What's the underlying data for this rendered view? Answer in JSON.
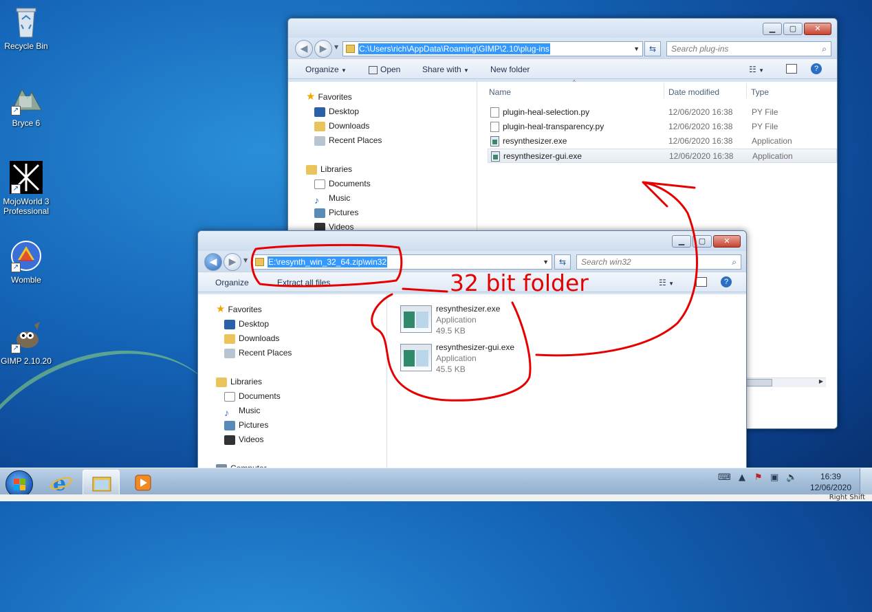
{
  "desktop": {
    "icons": [
      {
        "label": "Recycle Bin",
        "icon": "recycle-bin-icon"
      },
      {
        "label": "Bryce 6",
        "icon": "bryce-icon"
      },
      {
        "label": "MojoWorld 3 Professional",
        "icon": "mojoworld-icon"
      },
      {
        "label": "Womble",
        "icon": "womble-icon"
      },
      {
        "label": "GIMP 2.10.20",
        "icon": "gimp-icon"
      }
    ]
  },
  "window_back": {
    "address": "C:\\Users\\rich\\AppData\\Roaming\\GIMP\\2.10\\plug-ins",
    "search_placeholder": "Search plug-ins",
    "toolbar": {
      "organize": "Organize",
      "open": "Open",
      "share_with": "Share with",
      "new_folder": "New folder"
    },
    "nav": {
      "favorites": "Favorites",
      "favorites_items": [
        "Desktop",
        "Downloads",
        "Recent Places"
      ],
      "libraries": "Libraries",
      "libraries_items": [
        "Documents",
        "Music",
        "Pictures",
        "Videos"
      ]
    },
    "columns": {
      "name": "Name",
      "date": "Date modified",
      "type": "Type"
    },
    "files": [
      {
        "name": "plugin-heal-selection.py",
        "date": "12/06/2020 16:38",
        "type": "PY File",
        "kind": "py"
      },
      {
        "name": "plugin-heal-transparency.py",
        "date": "12/06/2020 16:38",
        "type": "PY File",
        "kind": "py"
      },
      {
        "name": "resynthesizer.exe",
        "date": "12/06/2020 16:38",
        "type": "Application",
        "kind": "app"
      },
      {
        "name": "resynthesizer-gui.exe",
        "date": "12/06/2020 16:38",
        "type": "Application",
        "kind": "app"
      }
    ]
  },
  "window_front": {
    "address": "E:\\resynth_win_32_64.zip\\win32",
    "search_placeholder": "Search win32",
    "toolbar": {
      "organize": "Organize",
      "extract": "Extract all files"
    },
    "nav": {
      "favorites": "Favorites",
      "favorites_items": [
        "Desktop",
        "Downloads",
        "Recent Places"
      ],
      "libraries": "Libraries",
      "libraries_items": [
        "Documents",
        "Music",
        "Pictures",
        "Videos"
      ],
      "computer": "Computer"
    },
    "files": [
      {
        "name": "resynthesizer.exe",
        "type": "Application",
        "size": "49.5 KB"
      },
      {
        "name": "resynthesizer-gui.exe",
        "type": "Application",
        "size": "45.5 KB"
      }
    ]
  },
  "annotation": {
    "label": "32 bit folder",
    "color": "#e60000"
  },
  "taskbar": {
    "time": "16:39",
    "date": "12/06/2020",
    "right_shift_label": "Right Shift"
  }
}
